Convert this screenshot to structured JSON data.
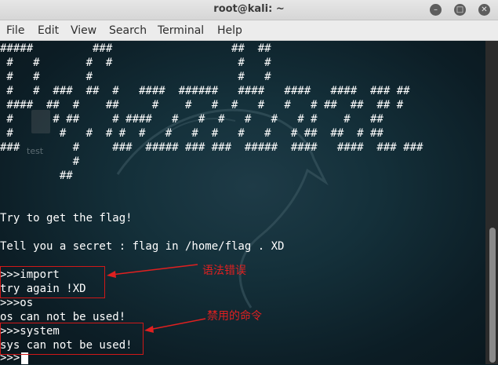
{
  "window": {
    "title": "root@kali: ~",
    "minimize_icon": "minimize-icon",
    "maximize_icon": "maximize-icon",
    "close_icon": "close-icon"
  },
  "menu": [
    "File",
    "Edit",
    "View",
    "Search",
    "Terminal",
    "Help"
  ],
  "desktop_icon_label": "test",
  "banner": [
    "#####         ###                  ##  ##",
    " #   #       #  #                   #   #",
    " #   #       #                      #   #",
    " #   #  ###  ##  #   ####  ######   ####   ####   ####  ### ##",
    " ####  ##  #    ##     #    #   #  #   #   #   # ##  ##  ## #",
    " #      # ##     # ####   #   #  #   #   #   # #    #   ##",
    " #       #   #  # #  #   #   #  #   #   #   # ##  ##  # ##",
    "###        #     ###  ##### ### ###  #####  ####   ####  ### ###",
    "           #",
    "         ##"
  ],
  "lines": {
    "try": "Try to get the flag!",
    "secret": "Tell you a secret : flag in /home/flag . XD",
    "cmd1": ">>>import",
    "out1": "try again !XD",
    "cmd2": ">>>os",
    "out2": "os can not be used!",
    "cmd3": ">>>system",
    "out3": "sys can not be used!",
    "prompt": ">>>"
  },
  "annotations": {
    "syntax_error": "语法错误",
    "banned_command": "禁用的命令",
    "color": "#e02020"
  }
}
